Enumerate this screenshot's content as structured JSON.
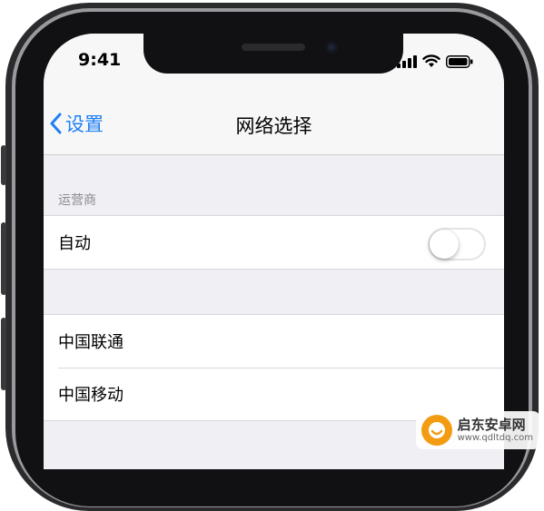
{
  "status_bar": {
    "time": "9:41"
  },
  "nav": {
    "back_label": "设置",
    "title": "网络选择"
  },
  "carrier_section": {
    "header": "运营商",
    "auto_row": {
      "label": "自动",
      "toggle_on": false
    }
  },
  "networks": [
    {
      "label": "中国联通"
    },
    {
      "label": "中国移动"
    }
  ],
  "watermark": {
    "name": "启东安卓网",
    "url": "www.qdltdq.com"
  },
  "colors": {
    "accent": "#1f7ff5",
    "background": "#efeff4"
  }
}
